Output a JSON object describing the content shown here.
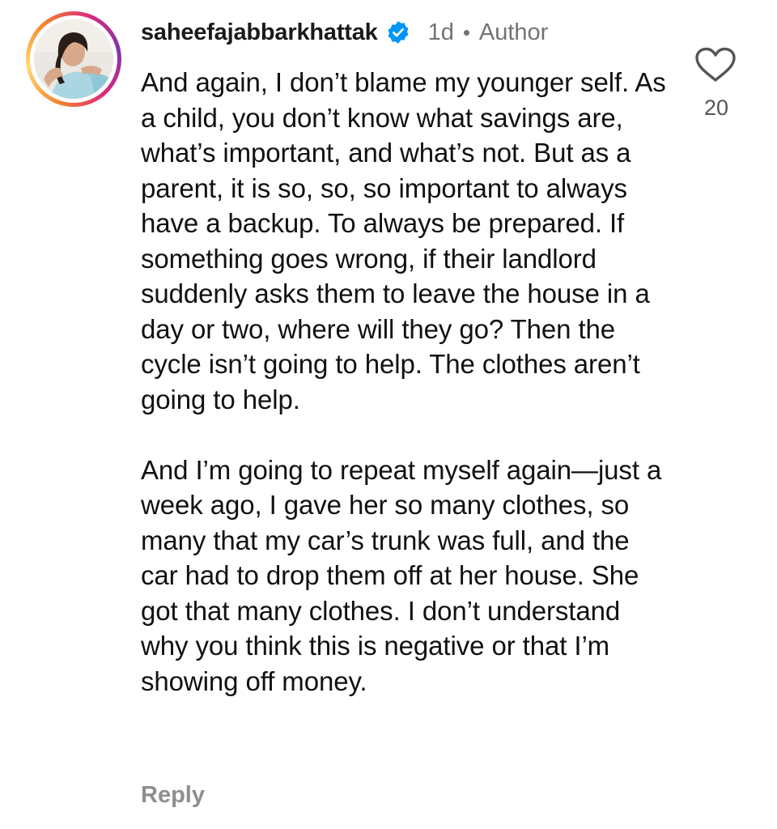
{
  "comment": {
    "username": "saheefajabbarkhattak",
    "verified_icon": "verified-badge-icon",
    "time_ago": "1d",
    "author_label": "Author",
    "paragraphs": [
      "And again, I don’t blame my younger self. As a child, you don’t know what savings are, what’s important, and what’s not. But as a parent, it is so, so, so important to always have a backup. To always be prepared. If something goes wrong, if their landlord suddenly asks them to leave the house in a day or two, where will they go? Then the cycle isn’t going to help. The clothes aren’t going to help.",
      "And I’m going to repeat myself again—just a week ago, I gave her so many clothes, so many that my car’s trunk was full, and the car had to drop them off at her house. She got that many clothes. I don’t understand why you think this is negative or that I’m showing off money."
    ],
    "reply_label": "Reply",
    "like_icon": "heart-icon",
    "like_count": "20"
  },
  "colors": {
    "verified_badge": "#0095f6",
    "meta_text": "#737373",
    "reply_text": "#8e8e8e",
    "story_ring_start": "#f58529",
    "story_ring_end": "#dd2a7b"
  }
}
